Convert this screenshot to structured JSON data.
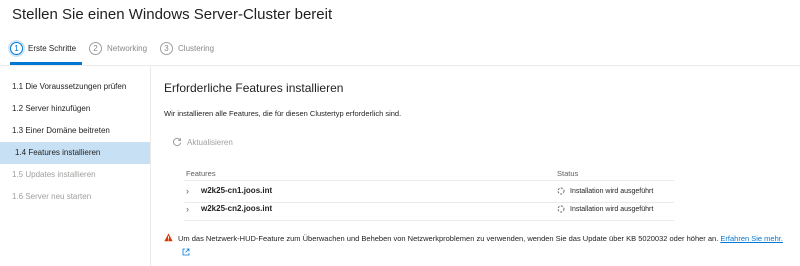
{
  "wizard": {
    "title": "Stellen Sie einen Windows Server-Cluster bereit"
  },
  "steps": [
    {
      "num": "1",
      "label": "Erste Schritte"
    },
    {
      "num": "2",
      "label": "Networking"
    },
    {
      "num": "3",
      "label": "Clustering"
    }
  ],
  "sidebar": {
    "items": [
      {
        "label": "1.1  Die Voraussetzungen prüfen"
      },
      {
        "label": "1.2  Server hinzufügen"
      },
      {
        "label": "1.3  Einer Domäne beitreten"
      },
      {
        "label": "1.4  Features installieren"
      },
      {
        "label": "1.5  Updates installieren"
      },
      {
        "label": "1.6  Server neu starten"
      }
    ]
  },
  "main": {
    "title": "Erforderliche Features installieren",
    "description": "Wir installieren alle Features, die für diesen Clustertyp erforderlich sind.",
    "refresh_label": "Aktualisieren",
    "table": {
      "columns": [
        "Features",
        "Status"
      ],
      "rows": [
        {
          "host": "w2k25-cn1.joos.int",
          "status": "Installation wird ausgeführt"
        },
        {
          "host": "w2k25-cn2.joos.int",
          "status": "Installation wird ausgeführt"
        }
      ]
    },
    "warning": {
      "text": "Um das Netzwerk-HUD-Feature zum Überwachen und Beheben von Netzwerkproblemen zu verwenden, wenden Sie das Update über KB 5020032 oder höher an.",
      "link": "Erfahren Sie mehr."
    }
  },
  "colors": {
    "accent": "#0078d4",
    "active_item_bg": "#c7e0f4",
    "warning": "#d83b01"
  }
}
